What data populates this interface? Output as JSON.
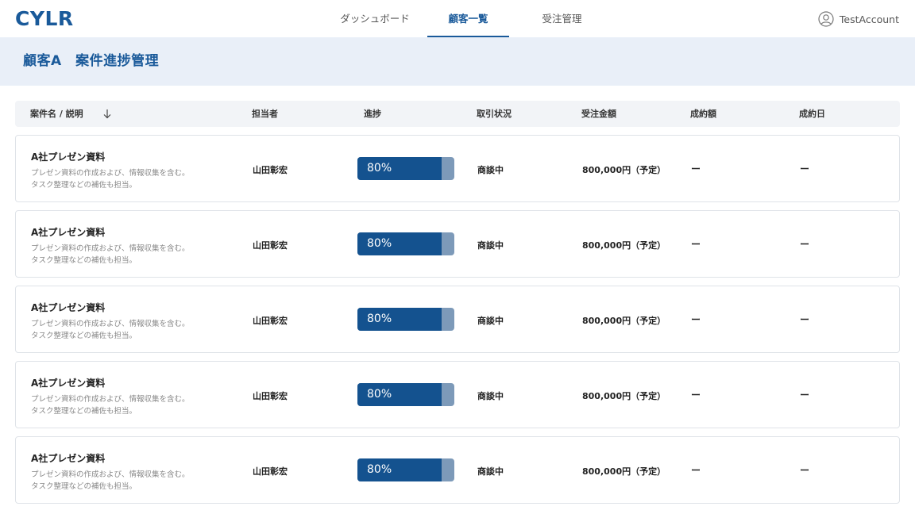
{
  "app": {
    "logo": "CYLR"
  },
  "nav": {
    "tabs": [
      {
        "label": "ダッシュボード",
        "active": false
      },
      {
        "label": "顧客一覧",
        "active": true
      },
      {
        "label": "受注管理",
        "active": false
      }
    ]
  },
  "account": {
    "label": "TestAccount",
    "icon": "user-circle-icon"
  },
  "page": {
    "title": "顧客A　案件進捗管理"
  },
  "colors": {
    "accent": "#1a5a9a",
    "progress_fill": "#14528f",
    "progress_track": "#7d9ab9",
    "band": "#e9eff8"
  },
  "table": {
    "headers": {
      "case": "案件名 / 説明",
      "assignee": "担当者",
      "progress": "進捗",
      "status": "取引状況",
      "amount": "受注金額",
      "closed_amount": "成約額",
      "closed_date": "成約日"
    },
    "sort_icon": "arrow-down-icon",
    "rows": [
      {
        "name": "A社プレゼン資料",
        "desc1": "プレゼン資料の作成および、情報収集を含む。",
        "desc2": "タスク整理などの補佐も担当。",
        "assignee": "山田彰宏",
        "progress": 0.8,
        "progress_label": "80%",
        "status": "商談中",
        "amount": "800,000円（予定）",
        "closed_amount": "ー",
        "closed_date": "ー"
      },
      {
        "name": "A社プレゼン資料",
        "desc1": "プレゼン資料の作成および、情報収集を含む。",
        "desc2": "タスク整理などの補佐も担当。",
        "assignee": "山田彰宏",
        "progress": 0.8,
        "progress_label": "80%",
        "status": "商談中",
        "amount": "800,000円（予定）",
        "closed_amount": "ー",
        "closed_date": "ー"
      },
      {
        "name": "A社プレゼン資料",
        "desc1": "プレゼン資料の作成および、情報収集を含む。",
        "desc2": "タスク整理などの補佐も担当。",
        "assignee": "山田彰宏",
        "progress": 0.8,
        "progress_label": "80%",
        "status": "商談中",
        "amount": "800,000円（予定）",
        "closed_amount": "ー",
        "closed_date": "ー"
      },
      {
        "name": "A社プレゼン資料",
        "desc1": "プレゼン資料の作成および、情報収集を含む。",
        "desc2": "タスク整理などの補佐も担当。",
        "assignee": "山田彰宏",
        "progress": 0.8,
        "progress_label": "80%",
        "status": "商談中",
        "amount": "800,000円（予定）",
        "closed_amount": "ー",
        "closed_date": "ー"
      },
      {
        "name": "A社プレゼン資料",
        "desc1": "プレゼン資料の作成および、情報収集を含む。",
        "desc2": "タスク整理などの補佐も担当。",
        "assignee": "山田彰宏",
        "progress": 0.8,
        "progress_label": "80%",
        "status": "商談中",
        "amount": "800,000円（予定）",
        "closed_amount": "ー",
        "closed_date": "ー"
      }
    ]
  }
}
